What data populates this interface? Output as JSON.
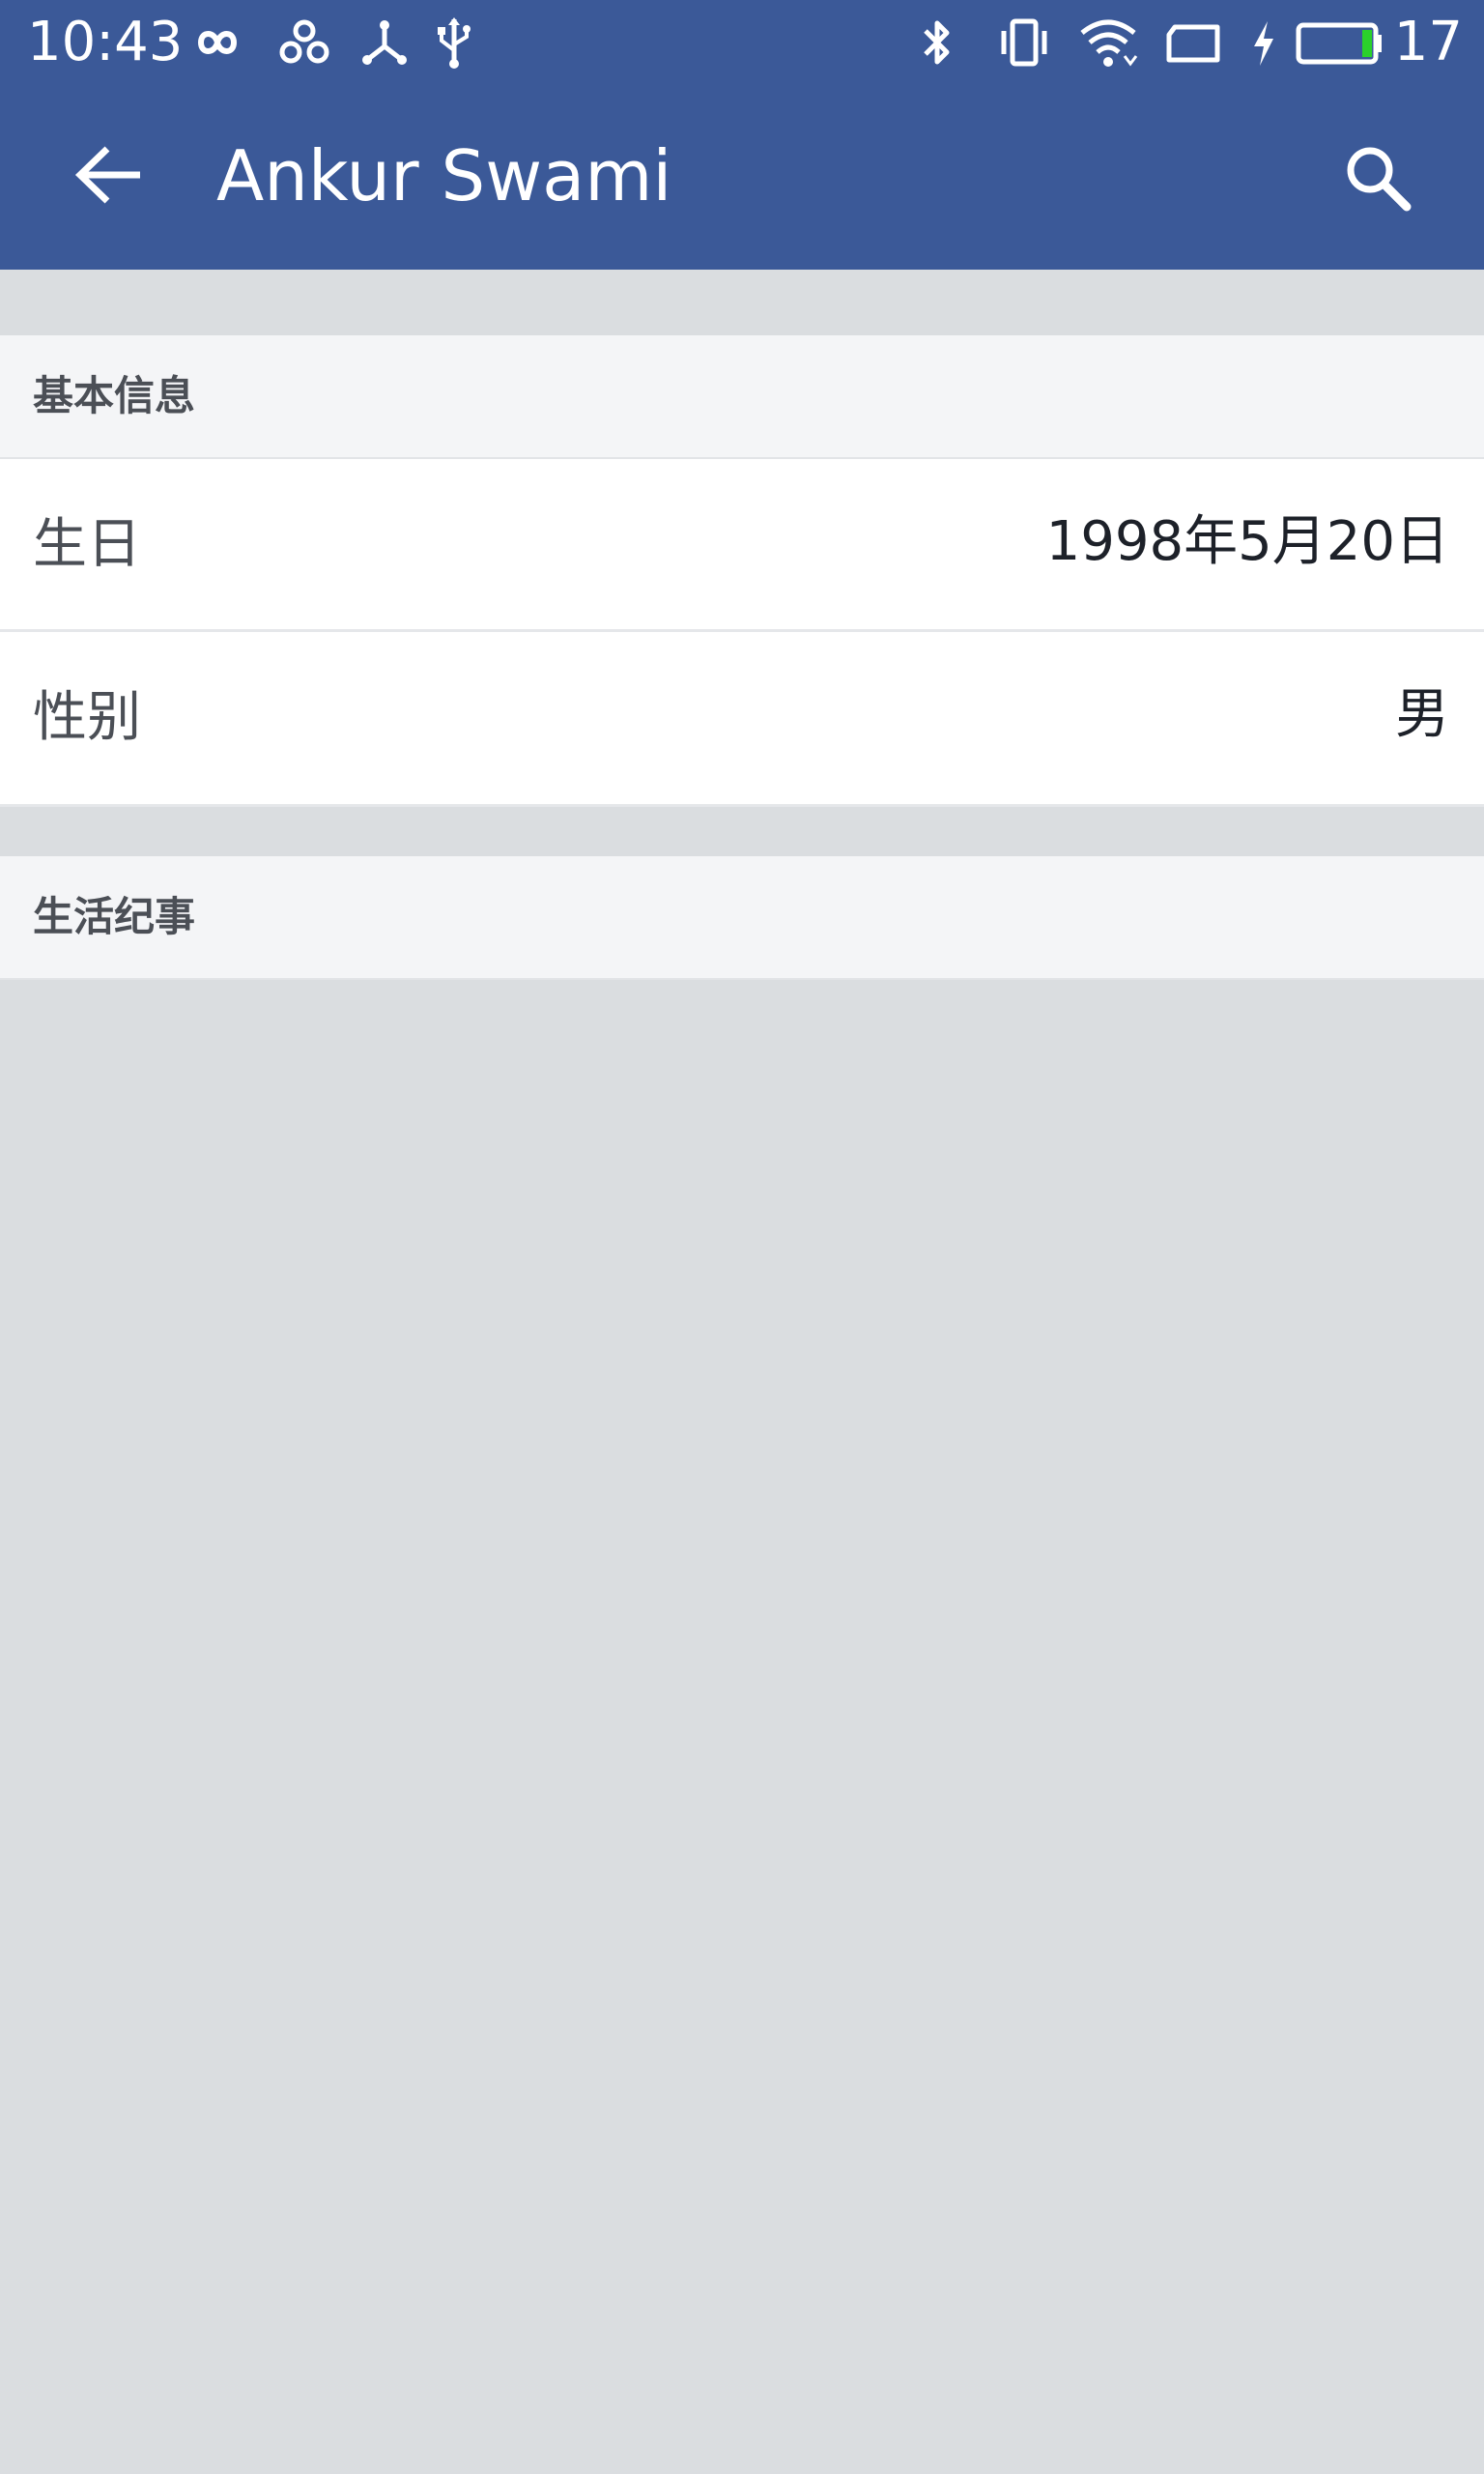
{
  "status_bar": {
    "time": "10:43",
    "battery_level": "17",
    "left_icons": [
      "infinity-icon",
      "triple-ring-icon",
      "share-node-icon",
      "usb-icon"
    ],
    "right_icons": [
      "bluetooth-icon",
      "vibrate-icon",
      "wifi-icon",
      "screen-rotation-icon",
      "charging-icon",
      "battery-icon"
    ]
  },
  "app_bar": {
    "title": "Ankur Swami",
    "back_icon": "arrow-left-icon",
    "search_icon": "search-icon"
  },
  "basic_info": {
    "header": "基本信息",
    "rows": [
      {
        "label": "生日",
        "value": "1998年5月20日"
      },
      {
        "label": "性别",
        "value": "男"
      }
    ]
  },
  "life_events": {
    "header": "生活纪事"
  },
  "colors": {
    "primary": "#3b5998",
    "page_background": "#dadde0",
    "header_background": "#f4f5f7",
    "battery_fill": "#2bd12b"
  }
}
